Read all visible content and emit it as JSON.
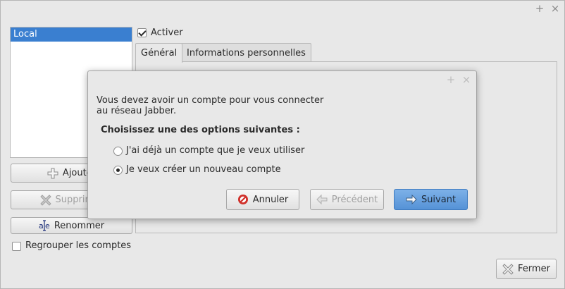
{
  "window": {
    "maximize_glyph": "+",
    "close_glyph": "×"
  },
  "accounts": {
    "items": [
      {
        "label": "Local",
        "selected": true
      }
    ],
    "add_label": "Ajouter",
    "delete_label": "Supprimer",
    "rename_label": "Renommer",
    "group_label": "Regrouper les comptes",
    "group_checked": false
  },
  "account_panel": {
    "enable_label": "Activer",
    "enable_checked": true,
    "tabs": [
      {
        "label": "Général",
        "active": true
      },
      {
        "label": "Informations personnelles",
        "active": false
      }
    ]
  },
  "footer": {
    "close_label": "Fermer"
  },
  "dialog": {
    "maximize_glyph": "+",
    "close_glyph": "×",
    "intro_line1": "Vous devez avoir un compte pour vous connecter",
    "intro_line2": "au réseau Jabber.",
    "prompt": "Choisissez une des options suivantes :",
    "options": [
      {
        "label": "J'ai déjà un compte que je veux utiliser",
        "selected": false
      },
      {
        "label": "Je veux créer un nouveau compte",
        "selected": true
      }
    ],
    "cancel_label": "Annuler",
    "previous_label": "Précédent",
    "next_label": "Suivant"
  },
  "colors": {
    "selection": "#3a7fd0",
    "primary_button": "#5f9bdc",
    "cancel_icon": "#d0302a"
  }
}
